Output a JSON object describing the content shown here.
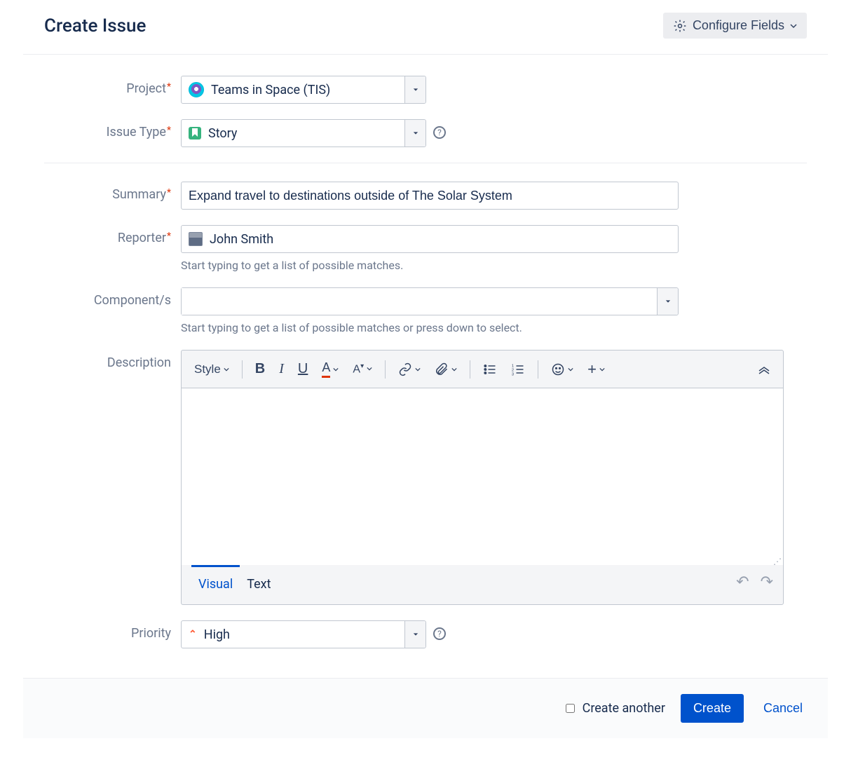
{
  "header": {
    "title": "Create Issue",
    "configure_label": "Configure Fields"
  },
  "fields": {
    "project": {
      "label": "Project",
      "value": "Teams in Space (TIS)"
    },
    "issue_type": {
      "label": "Issue Type",
      "value": "Story"
    },
    "summary": {
      "label": "Summary",
      "value": "Expand travel to destinations outside of The Solar System"
    },
    "reporter": {
      "label": "Reporter",
      "value": "John Smith",
      "hint": "Start typing to get a list of possible matches."
    },
    "components": {
      "label": "Component/s",
      "value": "",
      "hint": "Start typing to get a list of possible matches or press down to select."
    },
    "description": {
      "label": "Description",
      "value": ""
    },
    "priority": {
      "label": "Priority",
      "value": "High"
    }
  },
  "editor": {
    "style_label": "Style",
    "tabs": {
      "visual": "Visual",
      "text": "Text"
    }
  },
  "footer": {
    "create_another": "Create another",
    "create": "Create",
    "cancel": "Cancel"
  }
}
